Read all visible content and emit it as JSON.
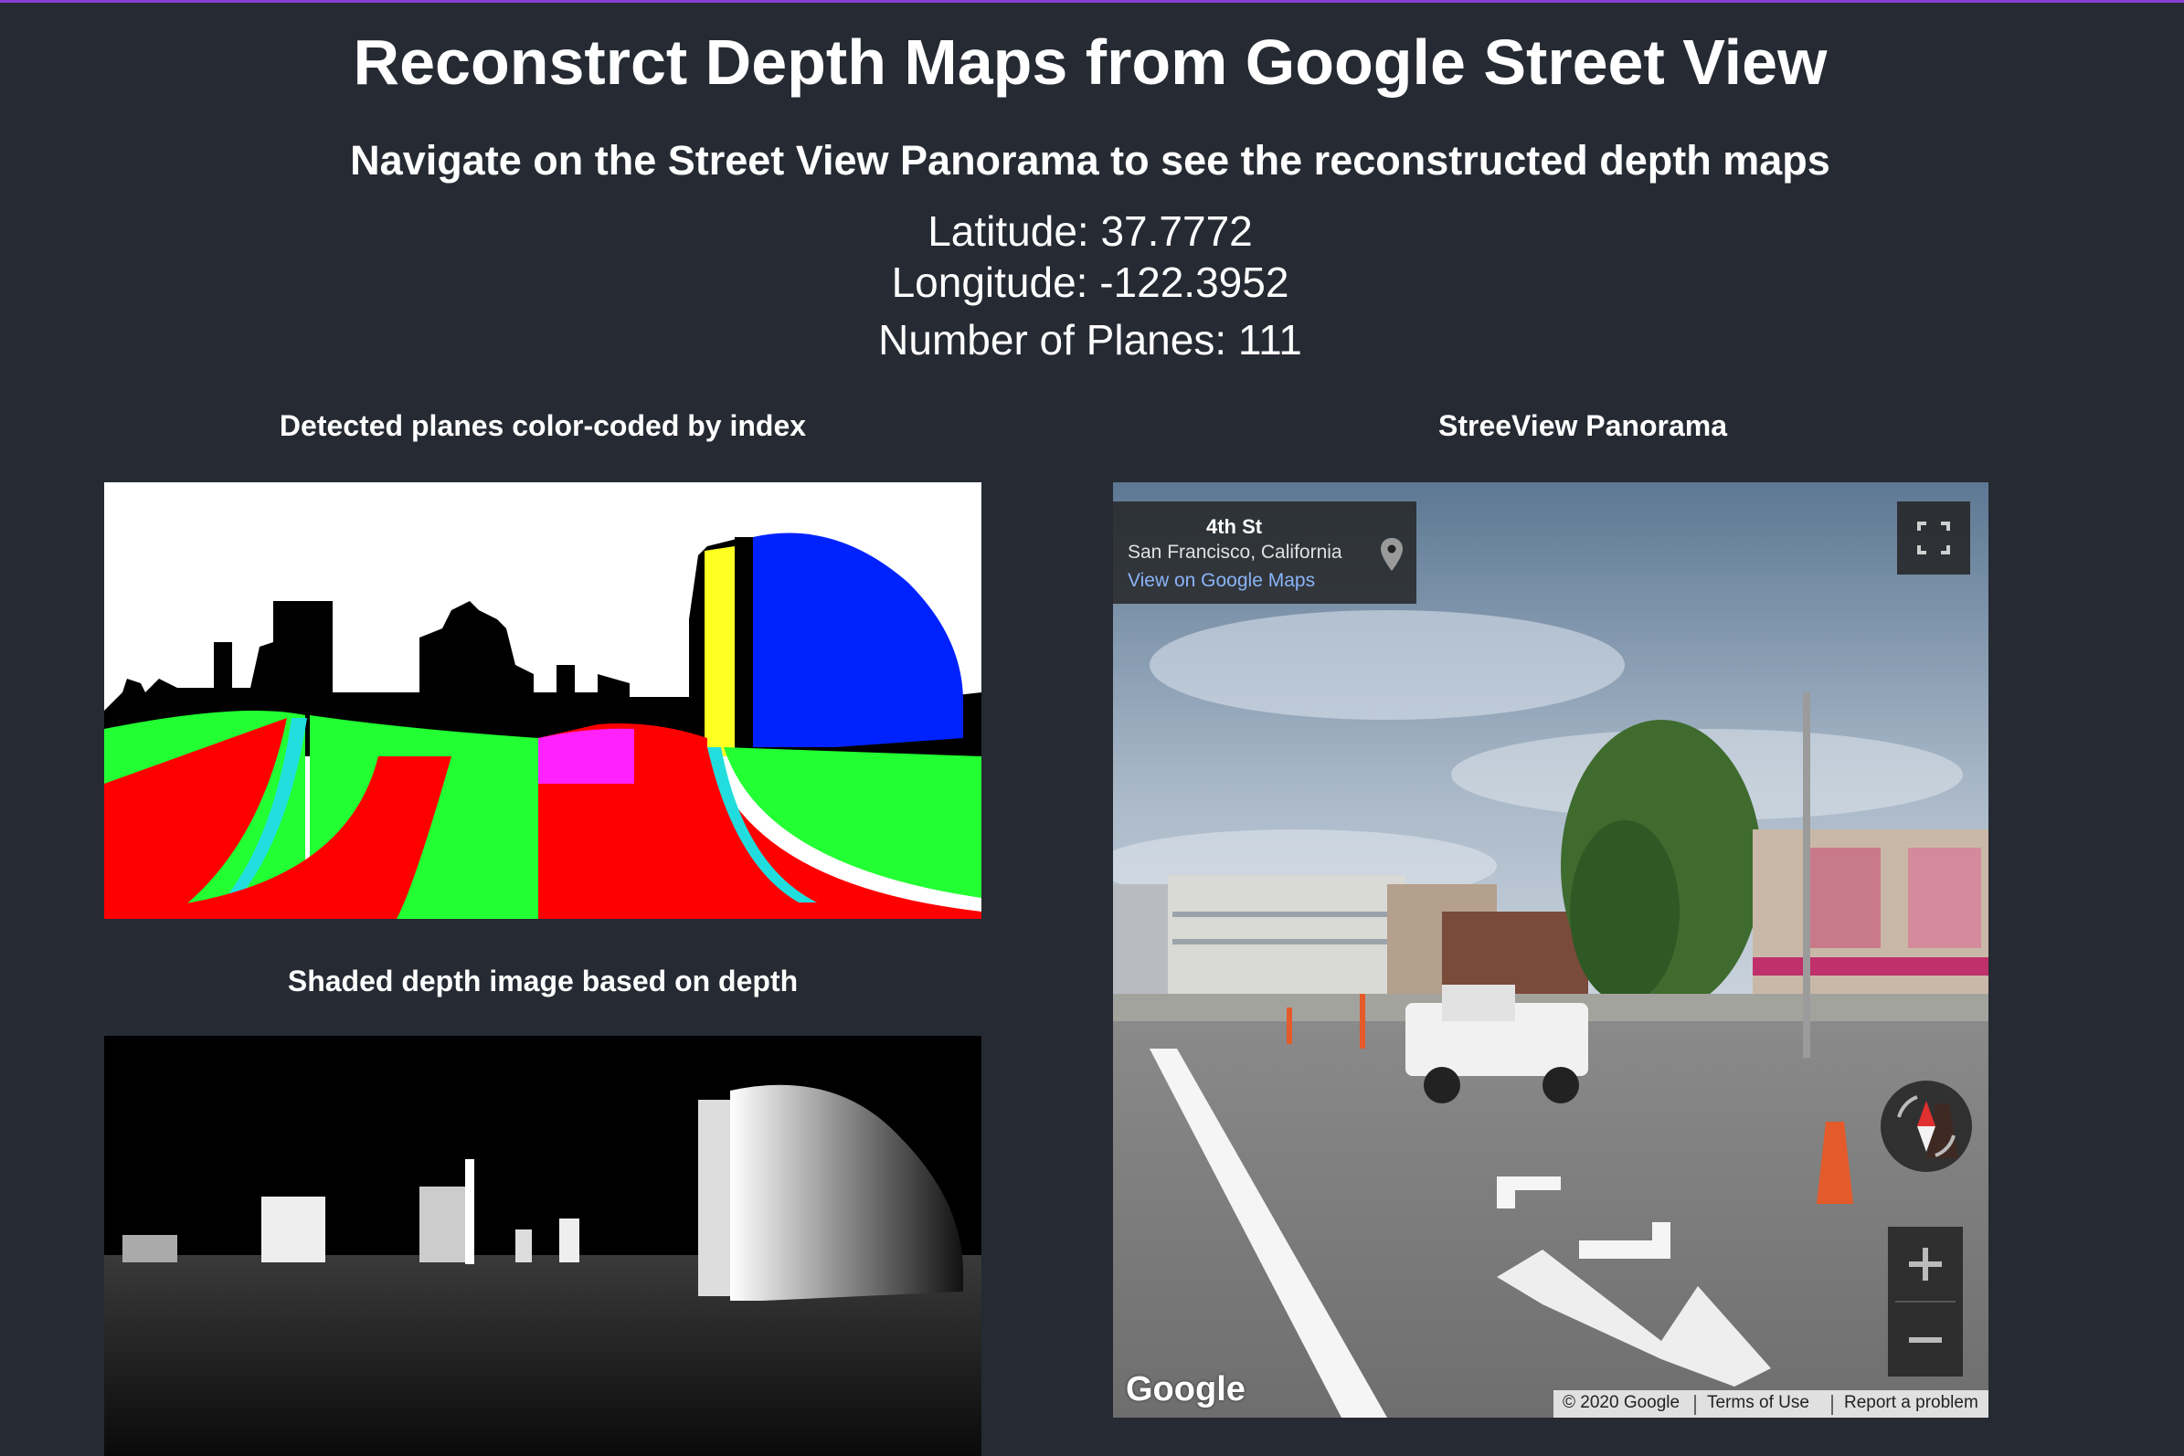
{
  "page": {
    "title": "Reconstrct Depth Maps from Google Street View",
    "subtitle": "Navigate on the Street View Panorama to see the reconstructed depth maps",
    "latitude_text": "Latitude: 37.7772",
    "longitude_text": "Longitude: -122.3952",
    "planes_text": "Number of Planes: 111"
  },
  "sections": {
    "planes_label": "Detected planes color-coded by index",
    "depth_label": "Shaded depth image based on depth",
    "panorama_label": "StreeView Panorama"
  },
  "streetview": {
    "street": "4th St",
    "city": "San Francisco, California",
    "maps_link": "View on Google Maps",
    "logo": "Google",
    "copyright": "© 2020 Google",
    "terms": "Terms of Use",
    "report": "Report a problem",
    "icons": [
      "map-pin-icon",
      "fullscreen-icon",
      "compass-icon",
      "zoom-in-icon",
      "zoom-out-icon",
      "nav-arrow-icon"
    ]
  },
  "colors": {
    "background": "#262a33",
    "accent_line": "#8b3fd1",
    "link": "#8ab4f8",
    "plane_colors": [
      "#ff0000",
      "#22ff33",
      "#0022ff",
      "#ffff22",
      "#ff22ff",
      "#22dddd",
      "#000000"
    ]
  }
}
